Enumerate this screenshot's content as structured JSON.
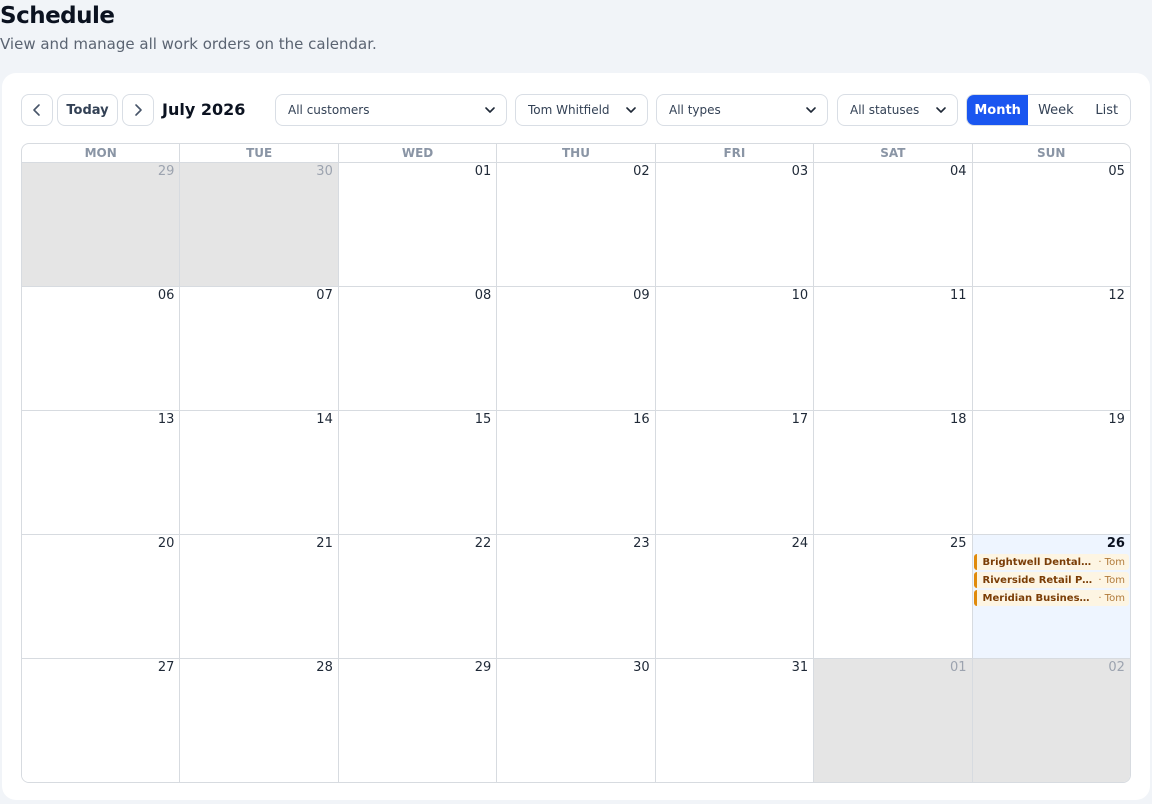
{
  "header": {
    "title": "Schedule",
    "subtitle": "View and manage all work orders on the calendar."
  },
  "toolbar": {
    "today_label": "Today",
    "month_label": "July 2026",
    "filters": {
      "customer": "All customers",
      "technician": "Tom Whitfield",
      "type": "All types",
      "status": "All statuses"
    },
    "views": [
      "Month",
      "Week",
      "List"
    ],
    "active_view": "Month"
  },
  "calendar": {
    "weekdays": [
      "MON",
      "TUE",
      "WED",
      "THU",
      "FRI",
      "SAT",
      "SUN"
    ],
    "weeks": [
      [
        {
          "n": "29",
          "other": true
        },
        {
          "n": "30",
          "other": true
        },
        {
          "n": "01"
        },
        {
          "n": "02"
        },
        {
          "n": "03"
        },
        {
          "n": "04"
        },
        {
          "n": "05"
        }
      ],
      [
        {
          "n": "06"
        },
        {
          "n": "07"
        },
        {
          "n": "08"
        },
        {
          "n": "09"
        },
        {
          "n": "10"
        },
        {
          "n": "11"
        },
        {
          "n": "12"
        }
      ],
      [
        {
          "n": "13"
        },
        {
          "n": "14"
        },
        {
          "n": "15"
        },
        {
          "n": "16"
        },
        {
          "n": "17"
        },
        {
          "n": "18"
        },
        {
          "n": "19"
        }
      ],
      [
        {
          "n": "20"
        },
        {
          "n": "21"
        },
        {
          "n": "22"
        },
        {
          "n": "23"
        },
        {
          "n": "24"
        },
        {
          "n": "25"
        },
        {
          "n": "26",
          "today": true,
          "events": [
            {
              "title": "Brightwell Dental Pra...",
              "tech": "· Tom"
            },
            {
              "title": "Riverside Retail Park",
              "tech": "· Tom"
            },
            {
              "title": "Meridian Business Ce...",
              "tech": "· Tom"
            }
          ]
        }
      ],
      [
        {
          "n": "27"
        },
        {
          "n": "28"
        },
        {
          "n": "29"
        },
        {
          "n": "30"
        },
        {
          "n": "31"
        },
        {
          "n": "01",
          "other": true
        },
        {
          "n": "02",
          "other": true
        }
      ]
    ]
  },
  "colors": {
    "accent": "#1a56f0",
    "other_month_bg": "#e5e5e5",
    "today_bg": "#eef5ff",
    "event_border": "#e08a0b",
    "event_bg": "#fdf5e3"
  }
}
